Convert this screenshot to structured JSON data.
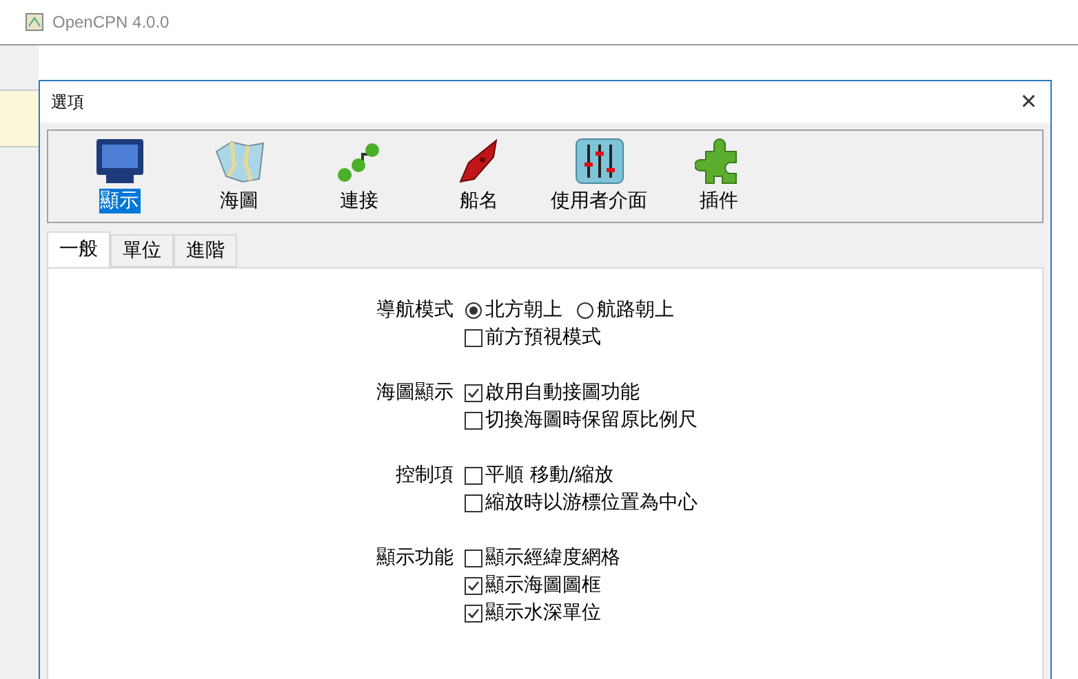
{
  "background_window": {
    "title": "OpenCPN 4.0.0"
  },
  "dialog": {
    "title": "選項",
    "close": "×"
  },
  "toolbar": [
    {
      "label": "顯示",
      "selected": true
    },
    {
      "label": "海圖",
      "selected": false
    },
    {
      "label": "連接",
      "selected": false
    },
    {
      "label": "船名",
      "selected": false
    },
    {
      "label": "使用者介面",
      "selected": false
    },
    {
      "label": "插件",
      "selected": false
    }
  ],
  "tabs": [
    {
      "label": "一般",
      "selected": true
    },
    {
      "label": "單位",
      "selected": false
    },
    {
      "label": "進階",
      "selected": false
    }
  ],
  "groups": [
    {
      "label": "導航模式",
      "rows": [
        [
          {
            "kind": "radio",
            "label": "北方朝上",
            "checked": true
          },
          {
            "kind": "radio",
            "label": "航路朝上",
            "checked": false
          }
        ],
        [
          {
            "kind": "checkbox",
            "label": "前方預視模式",
            "checked": false
          }
        ]
      ]
    },
    {
      "label": "海圖顯示",
      "rows": [
        [
          {
            "kind": "checkbox",
            "label": "啟用自動接圖功能",
            "checked": true
          }
        ],
        [
          {
            "kind": "checkbox",
            "label": "切換海圖時保留原比例尺",
            "checked": false
          }
        ]
      ]
    },
    {
      "label": "控制項",
      "rows": [
        [
          {
            "kind": "checkbox",
            "label": "平順 移動/縮放",
            "checked": false
          }
        ],
        [
          {
            "kind": "checkbox",
            "label": "縮放時以游標位置為中心",
            "checked": false
          }
        ]
      ]
    },
    {
      "label": "顯示功能",
      "rows": [
        [
          {
            "kind": "checkbox",
            "label": "顯示經緯度網格",
            "checked": false
          }
        ],
        [
          {
            "kind": "checkbox",
            "label": "顯示海圖圖框",
            "checked": true
          }
        ],
        [
          {
            "kind": "checkbox",
            "label": "顯示水深單位",
            "checked": true
          }
        ]
      ]
    }
  ]
}
